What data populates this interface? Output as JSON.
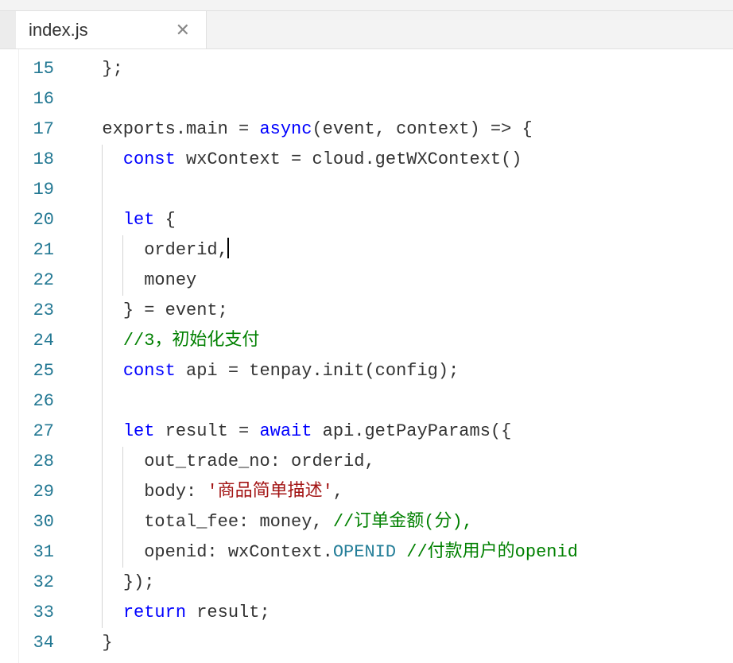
{
  "tab": {
    "label": "index.js"
  },
  "lineNumbers": [
    "15",
    "16",
    "17",
    "18",
    "19",
    "20",
    "21",
    "22",
    "23",
    "24",
    "25",
    "26",
    "27",
    "28",
    "29",
    "30",
    "31",
    "32",
    "33",
    "34"
  ],
  "code": {
    "l15": {
      "indent": "  ",
      "t1": "};"
    },
    "l16": {
      "indent": ""
    },
    "l17": {
      "indent": "  ",
      "t1": "exports.main = ",
      "k1": "async",
      "t2": "(event, context) => {"
    },
    "l18": {
      "indent": "    ",
      "k1": "const",
      "t1": " wxContext = cloud.getWXContext()"
    },
    "l19": {
      "indent": ""
    },
    "l20": {
      "indent": "    ",
      "k1": "let",
      "t1": " {"
    },
    "l21": {
      "indent": "      ",
      "t1": "orderid,"
    },
    "l22": {
      "indent": "      ",
      "t1": "money"
    },
    "l23": {
      "indent": "    ",
      "t1": "} = event;"
    },
    "l24": {
      "indent": "    ",
      "c1": "//3，初始化支付"
    },
    "l25": {
      "indent": "    ",
      "k1": "const",
      "t1": " api = tenpay.init(config);"
    },
    "l26": {
      "indent": ""
    },
    "l27": {
      "indent": "    ",
      "k1": "let",
      "t1": " result = ",
      "k2": "await",
      "t2": " api.getPayParams({"
    },
    "l28": {
      "indent": "      ",
      "t1": "out_trade_no: orderid,"
    },
    "l29": {
      "indent": "      ",
      "t1": "body: ",
      "s1": "'商品简单描述'",
      "t2": ","
    },
    "l30": {
      "indent": "      ",
      "t1": "total_fee: money, ",
      "c1": "//订单金额(分),"
    },
    "l31": {
      "indent": "      ",
      "t1": "openid: wxContext.",
      "cn1": "OPENID",
      "t2": " ",
      "c1": "//付款用户的openid"
    },
    "l32": {
      "indent": "    ",
      "t1": "});"
    },
    "l33": {
      "indent": "    ",
      "k1": "return",
      "t1": " result;"
    },
    "l34": {
      "indent": "  ",
      "t1": "}"
    }
  }
}
